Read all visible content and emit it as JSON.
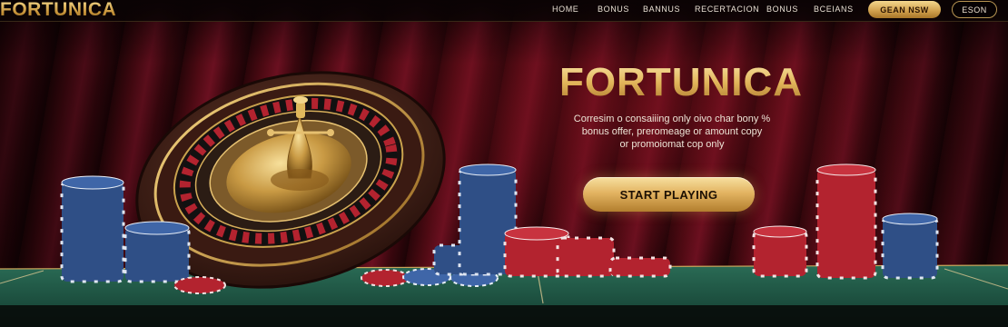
{
  "brand": {
    "logo_text": "FORTUNICA"
  },
  "nav": {
    "links": [
      "HOME",
      "BONUS",
      "BANNUS",
      "RECERTACION",
      "BONUS",
      "BCEIANS"
    ],
    "join_label": "GEAN NSW",
    "login_label": "ESON"
  },
  "hero": {
    "title": "FORTUNICA",
    "subtitle_lines": [
      "Corresim o consaiiing only oivo char bony %",
      "bonus offer, preromeage or amount copy",
      "or promoiomat cop only"
    ],
    "cta_label": "START PLAYING"
  },
  "scene": {
    "icons": [
      "roulette-wheel-icon",
      "poker-chip-stack-icon",
      "casino-table-icon"
    ]
  },
  "colors": {
    "gold": "#e2b55a",
    "curtain": "#6a1020",
    "table_felt": "#1f5b48",
    "chip_red": "#b3232f",
    "chip_blue": "#2f4f86"
  }
}
